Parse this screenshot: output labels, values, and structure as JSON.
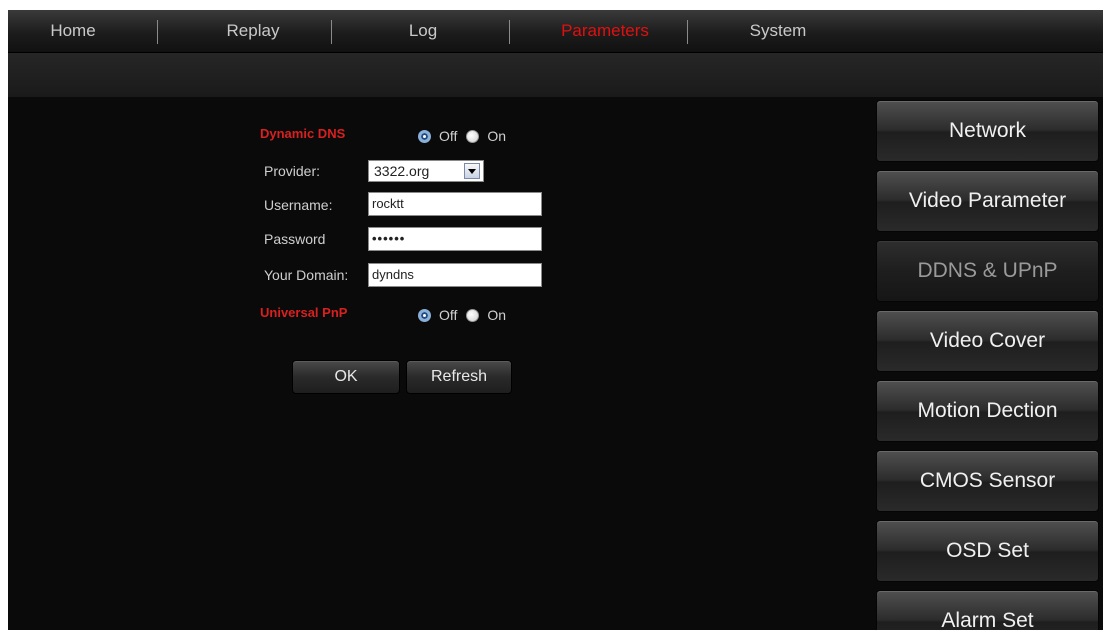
{
  "nav": {
    "items": [
      "Home",
      "Replay",
      "Log",
      "Parameters",
      "System"
    ],
    "active": "Parameters"
  },
  "ddns": {
    "title": "Dynamic DNS",
    "options": [
      "Off",
      "On"
    ],
    "selected": "Off",
    "provider_label": "Provider:",
    "provider_value": "3322.org",
    "username_label": "Username:",
    "username_value": "rocktt",
    "password_label": "Password",
    "password_value": "••••••",
    "domain_label": "Your Domain:",
    "domain_value": "dyndns"
  },
  "upnp": {
    "title": "Universal PnP",
    "options": [
      "Off",
      "On"
    ],
    "selected": "Off"
  },
  "buttons": {
    "ok": "OK",
    "refresh": "Refresh"
  },
  "sidebar": {
    "items": [
      "Network",
      "Video Parameter",
      "DDNS & UPnP",
      "Video Cover",
      "Motion Dection",
      "CMOS Sensor",
      "OSD Set",
      "Alarm Set"
    ],
    "active": "DDNS & UPnP"
  },
  "colors": {
    "accent": "#e01010",
    "background": "#0a0a0a"
  }
}
